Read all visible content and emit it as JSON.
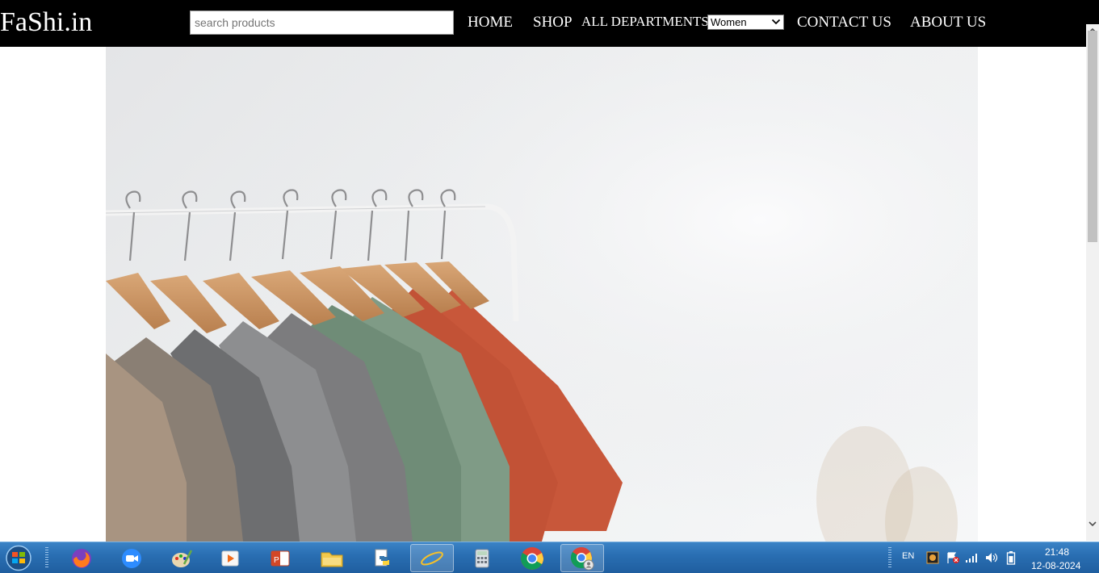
{
  "header": {
    "logo": "FaShi.in",
    "search_placeholder": "search products",
    "nav": {
      "home": "HOME",
      "shop": "SHOP",
      "departments_label": "ALL DEPARTMENTS",
      "department_selected": "Women",
      "contact": "CONTACT US",
      "about": "ABOUT US"
    }
  },
  "colors": {
    "header_bg": "#000000",
    "header_text": "#ffffff",
    "taskbar": "#2a6fb3"
  },
  "taskbar": {
    "apps": [
      "start-orb",
      "firefox-icon",
      "zoom-icon",
      "paint-icon",
      "media-player-icon",
      "powerpoint-icon",
      "file-explorer-icon",
      "python-icon",
      "internet-explorer-icon",
      "calculator-icon",
      "chrome-icon",
      "chrome-profile-icon"
    ],
    "language": "EN",
    "time": "21:48",
    "date": "12-08-2024"
  }
}
